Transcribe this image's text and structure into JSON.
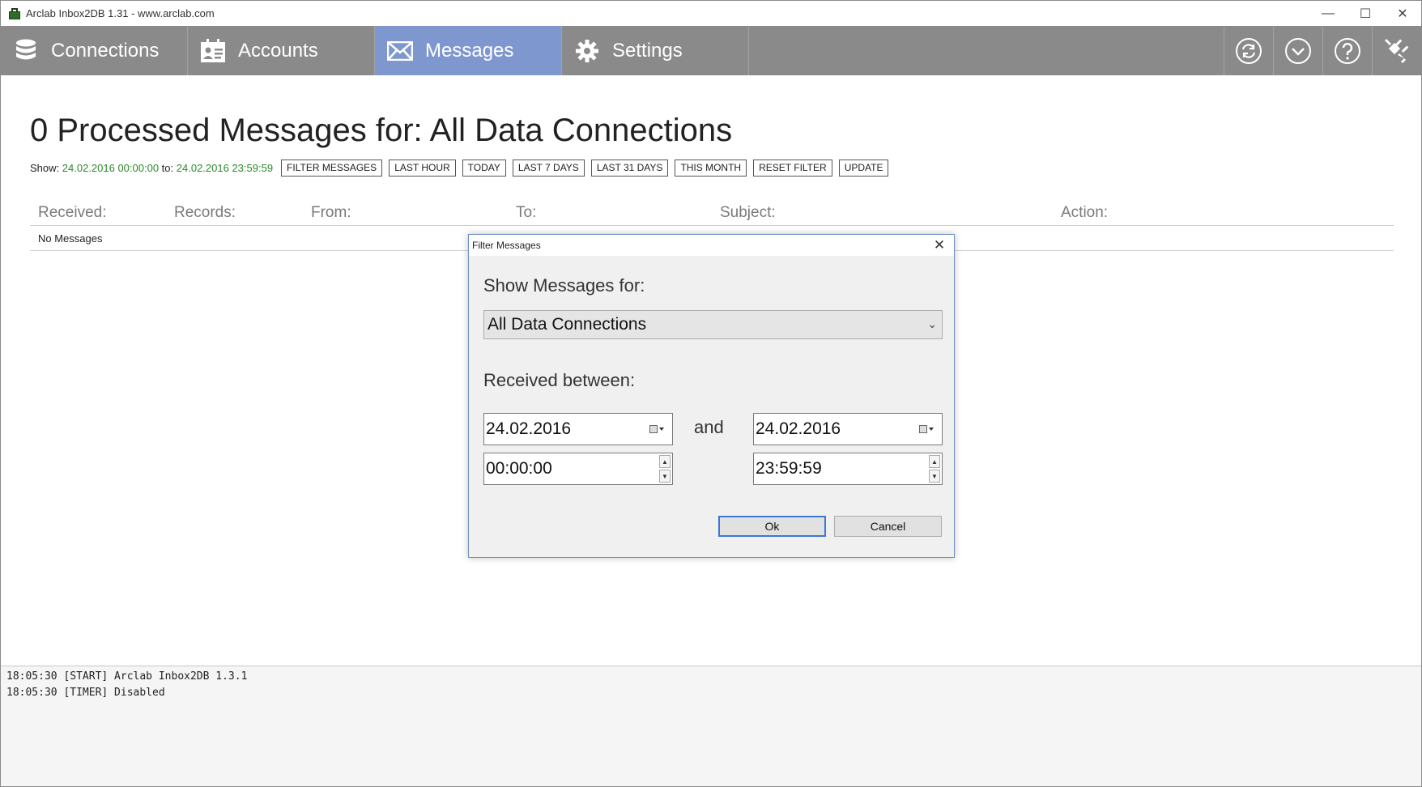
{
  "window": {
    "title": "Arclab Inbox2DB 1.31 - www.arclab.com",
    "minimize": "—",
    "maximize": "☐",
    "close": "✕"
  },
  "nav": {
    "tabs": [
      {
        "label": "Connections",
        "icon": "database-icon"
      },
      {
        "label": "Accounts",
        "icon": "accounts-card-icon"
      },
      {
        "label": "Messages",
        "icon": "envelope-icon",
        "active": true
      },
      {
        "label": "Settings",
        "icon": "gear-icon"
      }
    ],
    "right_icons": [
      "sync-icon",
      "timer-icon",
      "help-icon",
      "plugin-icon"
    ]
  },
  "main": {
    "title": "0 Processed Messages for: All Data Connections",
    "show_label": "Show:",
    "from_value": "24.02.2016 00:00:00",
    "to_label": "to:",
    "to_value": "24.02.2016 23:59:59",
    "buttons": {
      "filter": "FILTER MESSAGES",
      "last_hour": "LAST HOUR",
      "today": "TODAY",
      "last7": "LAST 7 DAYS",
      "last31": "LAST 31 DAYS",
      "this_month": "THIS MONTH",
      "reset": "RESET FILTER",
      "update": "UPDATE"
    }
  },
  "table": {
    "columns": [
      "Received:",
      "Records:",
      "From:",
      "To:",
      "Subject:",
      "Action:"
    ],
    "empty_text": "No Messages"
  },
  "log": {
    "lines": [
      "18:05:30 [START] Arclab Inbox2DB 1.3.1",
      "18:05:30 [TIMER] Disabled"
    ]
  },
  "dialog": {
    "title": "Filter Messages",
    "show_for_label": "Show Messages for:",
    "connection_selected": "All Data Connections",
    "received_between_label": "Received between:",
    "and_label": "and",
    "start_date": "24.02.2016",
    "start_time": "00:00:00",
    "end_date": "24.02.2016",
    "end_time": "23:59:59",
    "ok_label": "Ok",
    "cancel_label": "Cancel"
  },
  "colors": {
    "nav_bg": "#8a8a8a",
    "nav_active": "#7f97cf",
    "date_green": "#2a8a2a"
  }
}
